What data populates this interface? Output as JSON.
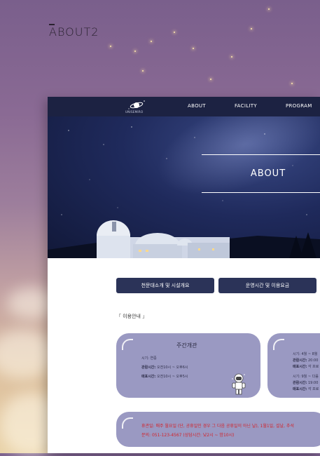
{
  "section_title": "ABOUT2",
  "nav": {
    "logo_text": "UNISEMIRO",
    "items": [
      "ABOUT",
      "FACILITY",
      "PROGRAM"
    ]
  },
  "hero": {
    "title": "ABOUT"
  },
  "buttons": [
    "천문대소개 및 시설개요",
    "운영시간 및 이용요금"
  ],
  "sub_label": {
    "open": "「",
    "text": "이용안내",
    "close": "」"
  },
  "card_weekly": {
    "title": "주간개관",
    "lines": [
      {
        "label": "",
        "value": "시기: 연중"
      },
      {
        "label": "관람시간:",
        "value": " 오전10시 ~ 오후6시"
      },
      {
        "label": "매표시간:",
        "value": " 오전10시 ~ 오후5시"
      }
    ]
  },
  "card_night": {
    "lines": [
      {
        "label": "",
        "value": "시기: 4월 ~ 8월"
      },
      {
        "label": "관람시간:",
        "value": " 20:00"
      },
      {
        "label": "매표시간:",
        "value": " 각 프로"
      },
      {
        "label": "",
        "value": "시기: 9월 ~ 다음"
      },
      {
        "label": "관람시간:",
        "value": " 19:00"
      },
      {
        "label": "매표시간:",
        "value": " 각 프로"
      }
    ]
  },
  "notice": {
    "line1": "휴관일: 매주 월요일 (단, 공휴일인 경우 그 다음 공휴일이 아닌 날), 1월1일, 설날, 추석",
    "line2": "문의: 051-123-4567 (상담시간: 낮2시 ~ 밤10시)"
  },
  "colors": {
    "nav": "#1c2242",
    "button": "#2b3358",
    "card": "#9a99c2",
    "notice_text": "#d2222a"
  }
}
